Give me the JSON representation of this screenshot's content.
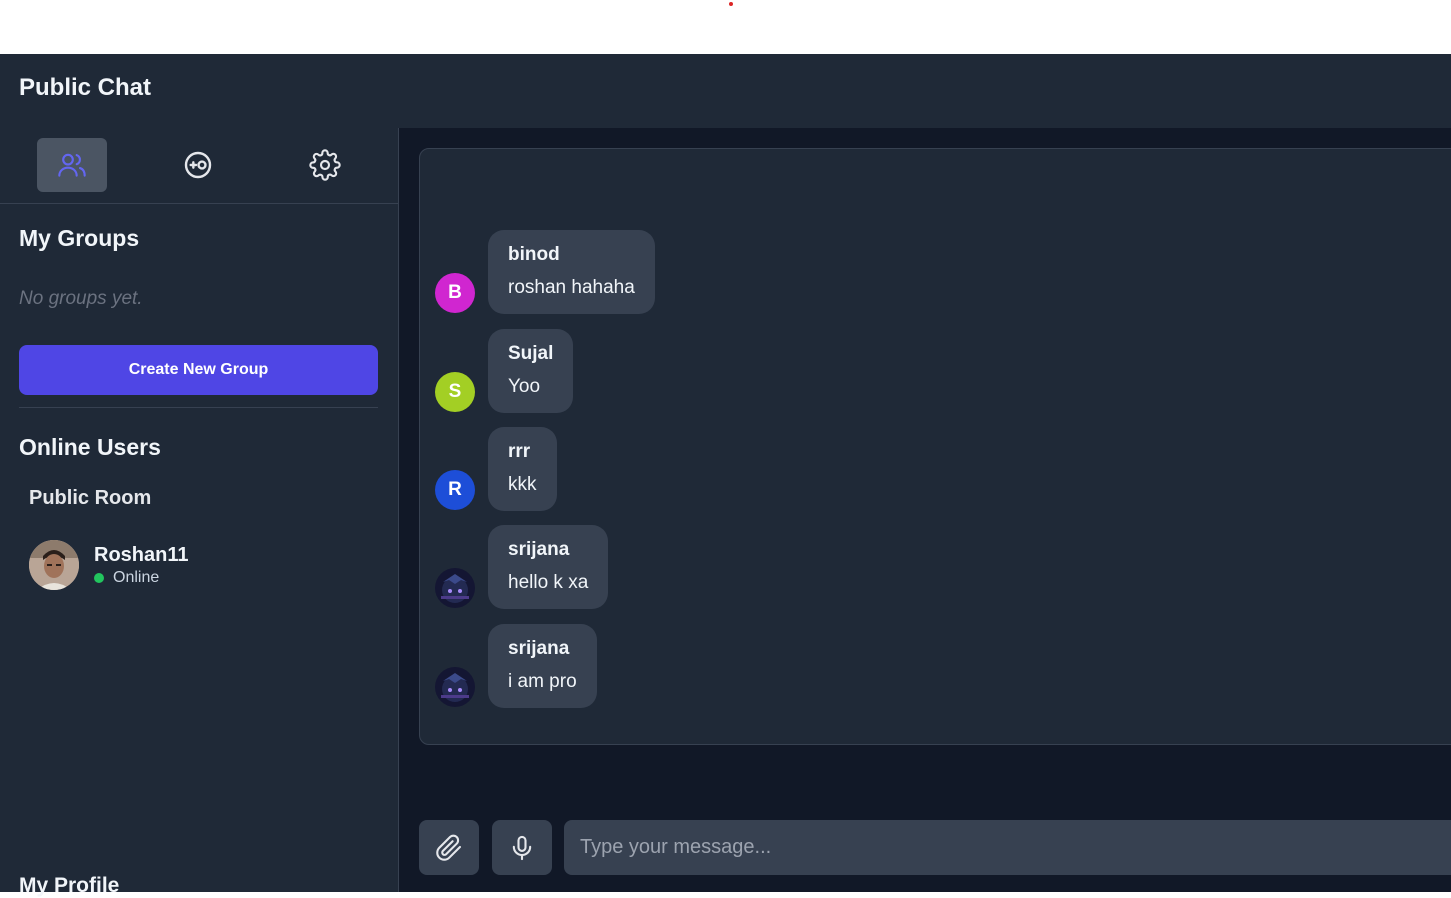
{
  "app": {
    "title": "Public Chat"
  },
  "colors": {
    "accent": "#4f46e5",
    "online": "#22c55e",
    "panel": "#1f2937",
    "background": "#111827"
  },
  "sidebar": {
    "tabs": [
      {
        "icon": "users-icon",
        "active": true
      },
      {
        "icon": "chat-add-icon",
        "active": false
      },
      {
        "icon": "gear-icon",
        "active": false
      }
    ],
    "groups": {
      "title": "My Groups",
      "empty_text": "No groups yet.",
      "create_label": "Create New Group"
    },
    "online": {
      "title": "Online Users",
      "room": "Public Room",
      "users": [
        {
          "name": "Roshan11",
          "status": "Online"
        }
      ]
    },
    "profile": {
      "title": "My Profile"
    }
  },
  "chat": {
    "messages": [
      {
        "sender": "binod",
        "text": "roshan hahaha",
        "initial": "B",
        "color": "#d026d0"
      },
      {
        "sender": "Sujal",
        "text": "Yoo",
        "initial": "S",
        "color": "#a3cf24"
      },
      {
        "sender": "rrr",
        "text": "kkk",
        "initial": "R",
        "color": "#1d4ed8"
      },
      {
        "sender": "srijana",
        "text": "hello k xa",
        "initial": "",
        "color": "#1e1b4b"
      },
      {
        "sender": "srijana",
        "text": "i am pro",
        "initial": "",
        "color": "#1e1b4b"
      }
    ],
    "input": {
      "placeholder": "Type your message...",
      "value": ""
    }
  }
}
